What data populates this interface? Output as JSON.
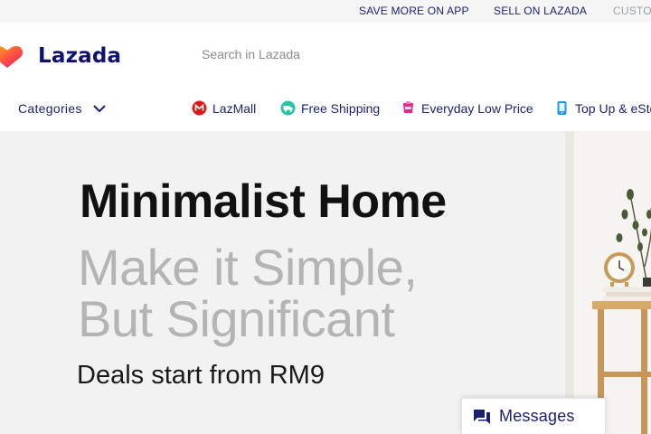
{
  "topbar": {
    "links": [
      "SAVE MORE ON APP",
      "SELL ON LAZADA",
      "CUSTO"
    ]
  },
  "header": {
    "logo_text": "Lazada",
    "search_placeholder": "Search in Lazada"
  },
  "nav": {
    "categories_label": "Categories",
    "items": [
      {
        "label": "LazMall",
        "icon": "lazmall-icon"
      },
      {
        "label": "Free Shipping",
        "icon": "free-shipping-icon"
      },
      {
        "label": "Everyday Low Price",
        "icon": "low-price-icon"
      },
      {
        "label": "Top Up & eSto",
        "icon": "top-up-icon"
      }
    ]
  },
  "banner": {
    "title": "Minimalist Home",
    "subtitle_line1": "Make it Simple,",
    "subtitle_line2": "But Significant",
    "deal": "Deals start from RM9"
  },
  "messages": {
    "label": "Messages"
  },
  "colors": {
    "brand_navy": "#0f136d",
    "nav_text": "#1a1f71",
    "banner_bg": "#f2f2f2",
    "subtitle_gray": "#b4b4b4"
  }
}
